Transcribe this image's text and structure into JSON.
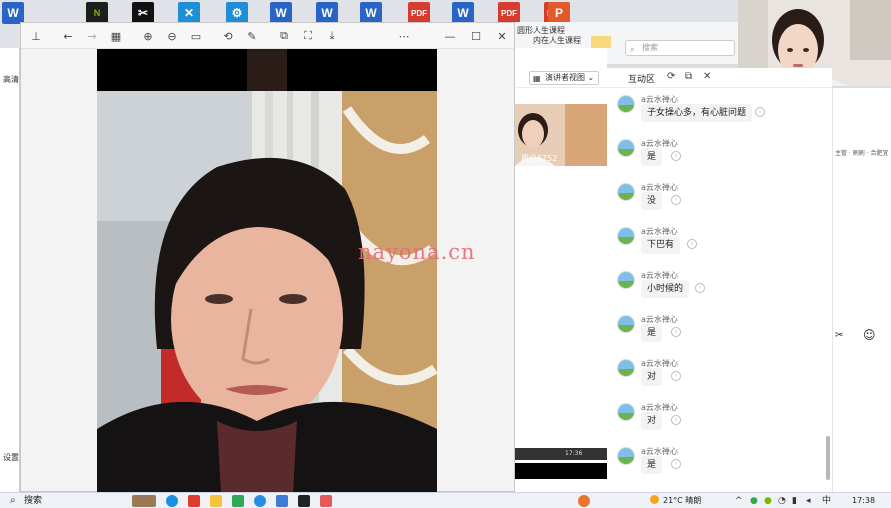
{
  "desktop": {
    "icons": [
      {
        "glyph": "W",
        "kind": "word",
        "label": "",
        "icon": "word-icon"
      },
      {
        "glyph": "N",
        "kind": "nv",
        "label": "",
        "icon": "nvidia-icon"
      },
      {
        "glyph": "✂",
        "kind": "cap",
        "label": "",
        "icon": "capcut-icon"
      },
      {
        "glyph": "✕",
        "kind": "blue",
        "label": "",
        "icon": "app-icon"
      },
      {
        "glyph": "⚙",
        "kind": "blue",
        "label": "",
        "icon": "tool-icon"
      },
      {
        "glyph": "W",
        "kind": "word",
        "label": "",
        "icon": "word-icon"
      },
      {
        "glyph": "W",
        "kind": "word",
        "label": "",
        "icon": "word-icon"
      },
      {
        "glyph": "W",
        "kind": "word",
        "label": "",
        "icon": "word-icon"
      },
      {
        "glyph": "PDF",
        "kind": "pdf",
        "label": "",
        "icon": "pdf-icon"
      },
      {
        "glyph": "W",
        "kind": "word",
        "label": "",
        "icon": "word-icon"
      },
      {
        "glyph": "PDF",
        "kind": "pdf",
        "label": "",
        "icon": "pdf-icon"
      },
      {
        "glyph": "PDF",
        "kind": "pdf",
        "label": "",
        "icon": "pdf-icon"
      },
      {
        "glyph": "P",
        "kind": "ppt",
        "label": "",
        "icon": "ppt-icon"
      }
    ],
    "top_labels": [
      "圆形人生课程",
      "内在人生课程"
    ]
  },
  "left_app": {
    "label_top": "高清",
    "label_bottom": "设置"
  },
  "viewer": {
    "toolbar_icons": [
      "pin-icon",
      "back-icon",
      "forward-icon",
      "grid-icon",
      "zoom-in-icon",
      "zoom-out-icon",
      "fit-icon",
      "rotate-icon",
      "edit-icon",
      "crop-icon",
      "capture-icon",
      "save-icon",
      "more-icon",
      "minimize-icon",
      "maximize-icon",
      "close-icon"
    ],
    "watermark": "nayona.cn"
  },
  "search": {
    "placeholder": "搜索"
  },
  "panel": {
    "view_mode": "演讲者视图",
    "title": "互动区",
    "thumb_label": "用户6752"
  },
  "chat": {
    "username": "a云水禅心",
    "messages": [
      {
        "text": "子女操心多，有心脏问题"
      },
      {
        "text": "是"
      },
      {
        "text": "没"
      },
      {
        "text": "下巴有"
      },
      {
        "text": "小时候的"
      },
      {
        "text": "是"
      },
      {
        "text": "对"
      },
      {
        "text": "对"
      },
      {
        "text": "是"
      }
    ]
  },
  "right_app": {
    "label": "主管 · 刷刷 · 合肥宜"
  },
  "mid_strip": {
    "time": "17:36"
  },
  "taskbar": {
    "search_label": "搜索",
    "weather": "21°C 晴朗",
    "time": "17:38"
  },
  "colors": {
    "watermark": "#e66a7a",
    "word": "#2b64c7",
    "pdf": "#d63b2f"
  }
}
